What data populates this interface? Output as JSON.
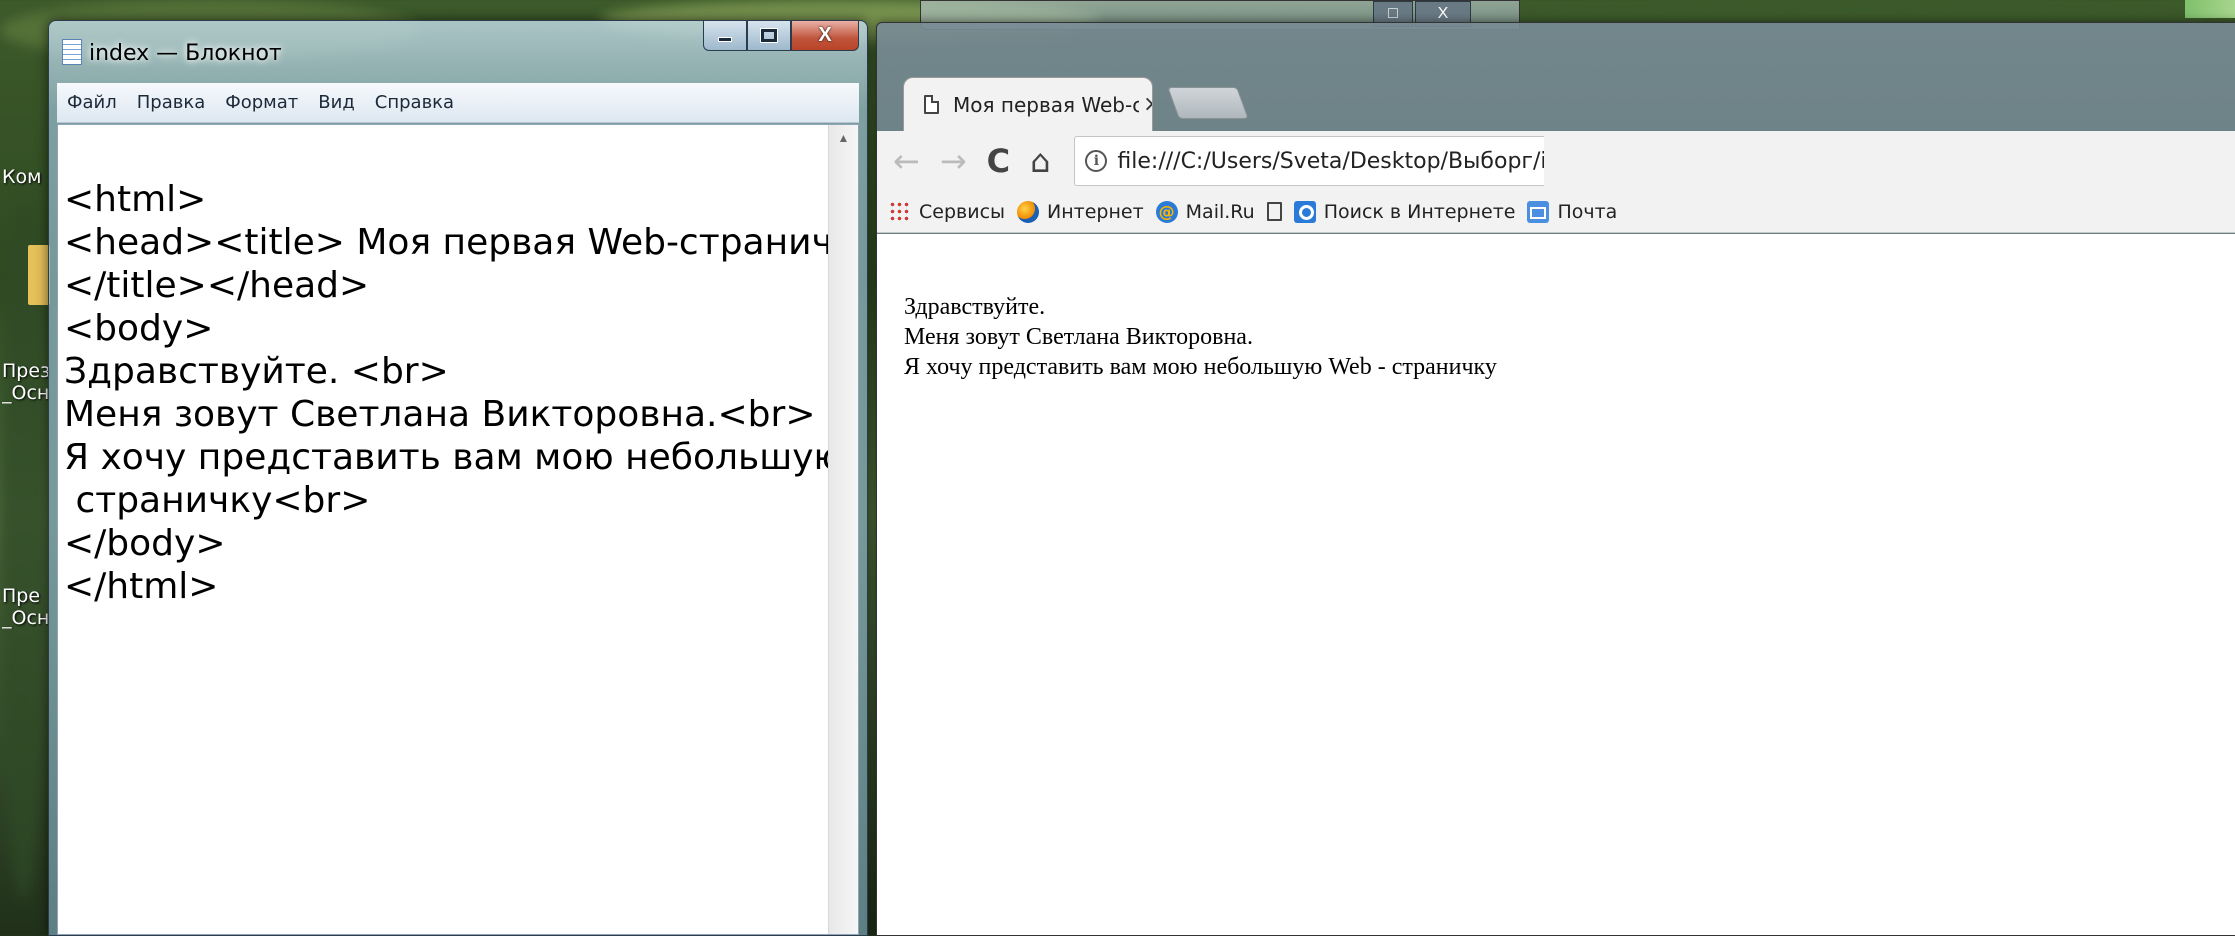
{
  "desktop": {
    "icon_labels": [
      "Ком",
      "През\n_Осн",
      "Пре\n_Осн"
    ]
  },
  "notepad": {
    "title": "index — Блокнот",
    "menu": [
      "Файл",
      "Правка",
      "Формат",
      "Вид",
      "Справка"
    ],
    "close_glyph": "X",
    "lines": [
      "<html>",
      "<head><title> Моя первая Web-страничка",
      "</title></head>",
      "<body>",
      "Здравствуйте. <br>",
      "Меня зовут Светлана Викторовна.<br>",
      "Я хочу представить вам мою небольшую Web",
      " страничку<br>",
      "</body>",
      "</html>"
    ],
    "scroll_up_glyph": "▲"
  },
  "browser": {
    "tab_title": "Моя первая Web-стран",
    "tab_close": "×",
    "nav": {
      "back": "←",
      "forward": "→",
      "reload": "C",
      "home": "⌂"
    },
    "info_glyph": "i",
    "address": "file:///C:/Users/Sveta/Desktop/Выборг/index.html",
    "bookmarks": [
      "Сервисы",
      "Интернет",
      "Mail.Ru",
      "",
      "Поиск в Интернете",
      "Почта"
    ],
    "content_lines": [
      "Здравствуйте.",
      "Меня зовут Светлана Викторовна.",
      "Я хочу представить вам мою небольшую Web - страничку"
    ],
    "back_window_close": "X"
  }
}
